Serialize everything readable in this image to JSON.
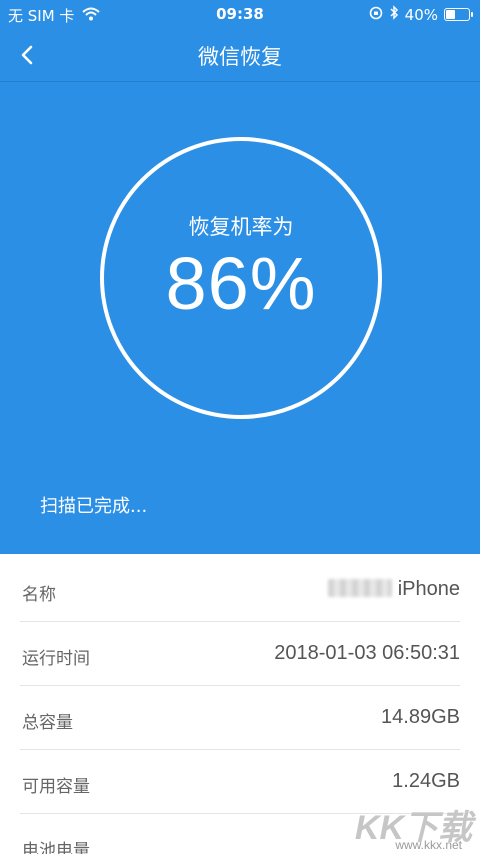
{
  "status_bar": {
    "carrier": "无 SIM 卡",
    "time": "09:38",
    "battery": "40%",
    "battery_level": 0.4
  },
  "nav": {
    "title": "微信恢复",
    "back_icon": "chevron-left-icon"
  },
  "hero": {
    "caption": "恢复机率为",
    "percent": "86%",
    "scan_status": "扫描已完成..."
  },
  "device_info": [
    {
      "label": "名称",
      "value": "iPhone"
    },
    {
      "label": "运行时间",
      "value": "2018-01-03 06:50:31"
    },
    {
      "label": "总容量",
      "value": "14.89GB"
    },
    {
      "label": "可用容量",
      "value": "1.24GB"
    },
    {
      "label": "电池电量",
      "value": ""
    }
  ],
  "watermark": {
    "logo": "KK下载",
    "url": "www.kkx.net"
  },
  "colors": {
    "primary": "#2b8fe6",
    "text_muted": "#666666"
  }
}
